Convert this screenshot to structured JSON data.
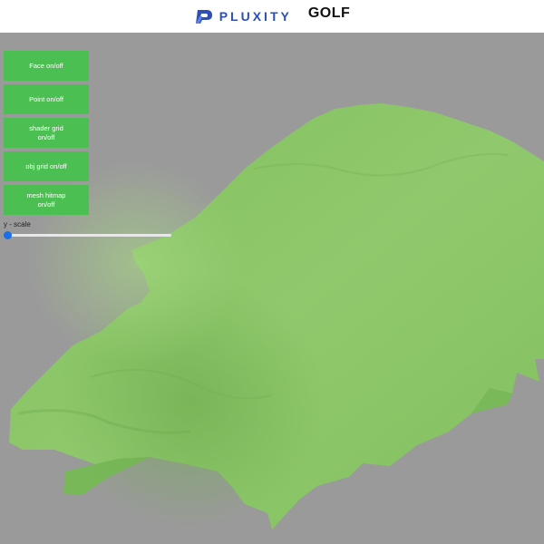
{
  "header": {
    "brand_name": "PLUXITY",
    "brand_logo": "pluxity-logo",
    "title": "GOLF"
  },
  "controls": {
    "buttons": [
      {
        "label": "Face on/off",
        "icon": null
      },
      {
        "label": "Point on/off",
        "icon": null
      },
      {
        "label": "shader grid on/off",
        "icon": null
      },
      {
        "label": "obj grid on/off",
        "icon": null
      },
      {
        "label": "mesh hitmap on/off",
        "icon": null
      }
    ],
    "slider": {
      "label": "y - scale",
      "value": 0
    }
  },
  "scene": {
    "background_color": "#9a9a9a",
    "terrain_color": "#8cc96a",
    "description_icon": "terrain-mesh"
  },
  "colors": {
    "button": "#4cbf52",
    "brand": "#2f4fb8",
    "slider_thumb": "#1a6fe8"
  }
}
